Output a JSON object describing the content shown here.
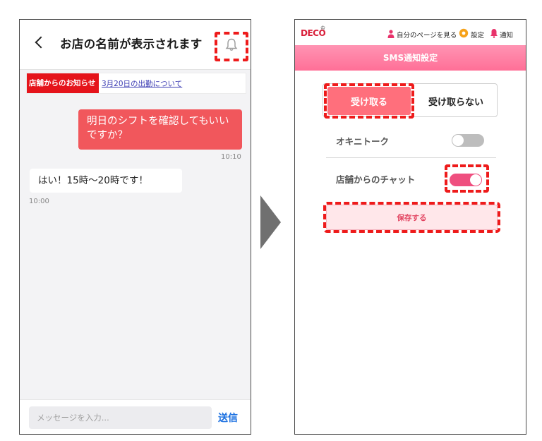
{
  "left_screen": {
    "header": {
      "title": "お店の名前が表示されます"
    },
    "notice": {
      "badge": "店舗からのお知らせ",
      "link": "3月20日の出勤について"
    },
    "messages": [
      {
        "text": "明日のシフトを確認してもいいですか？",
        "time": "10:10",
        "direction": "outgoing"
      },
      {
        "text": "はい！15時〜20時です！",
        "time": "10:00",
        "direction": "incoming"
      }
    ],
    "input": {
      "placeholder": "メッセージを入力...",
      "value": ""
    },
    "send_label": "送信"
  },
  "right_screen": {
    "logo": "DECO",
    "nav": {
      "mypage": "自分のページを見る",
      "settings": "設定",
      "notice": "通知"
    },
    "page_title": "SMS通知設定",
    "segment": {
      "receive": "受け取る",
      "not_receive": "受け取らない",
      "selected": "receive"
    },
    "settings": [
      {
        "label": "オキニトーク",
        "enabled": false
      },
      {
        "label": "店舗からのチャット",
        "enabled": true
      }
    ],
    "save_label": "保存する"
  },
  "colors": {
    "highlight": "#ee1b1b",
    "outgoing_bubble": "#f1575c",
    "accent_pink": "#ef4f7f",
    "send_blue": "#1a6fe0"
  }
}
